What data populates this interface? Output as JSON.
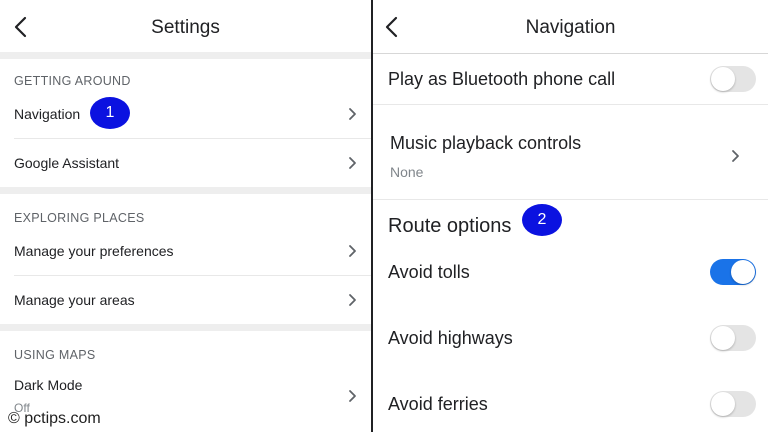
{
  "left": {
    "title": "Settings",
    "sections": [
      {
        "header": "GETTING AROUND",
        "items": [
          {
            "label": "Navigation"
          },
          {
            "label": "Google Assistant"
          }
        ]
      },
      {
        "header": "EXPLORING PLACES",
        "items": [
          {
            "label": "Manage your preferences"
          },
          {
            "label": "Manage your areas"
          }
        ]
      },
      {
        "header": "USING MAPS",
        "items": [
          {
            "label": "Dark Mode",
            "value": "Off"
          }
        ]
      }
    ],
    "annotation": "1"
  },
  "right": {
    "title": "Navigation",
    "bluetooth": {
      "label": "Play as Bluetooth phone call",
      "on": false
    },
    "music": {
      "label": "Music playback controls",
      "value": "None"
    },
    "route_options": {
      "heading": "Route options",
      "annotation": "2"
    },
    "toggles": [
      {
        "label": "Avoid tolls",
        "on": true
      },
      {
        "label": "Avoid highways",
        "on": false
      },
      {
        "label": "Avoid ferries",
        "on": false
      }
    ]
  },
  "watermark": "© pctips.com",
  "colors": {
    "accent": "#1a73e8",
    "annotation": "#0b12e0"
  },
  "icons": {
    "back": "chevron-left-icon",
    "forward": "chevron-right-icon"
  }
}
